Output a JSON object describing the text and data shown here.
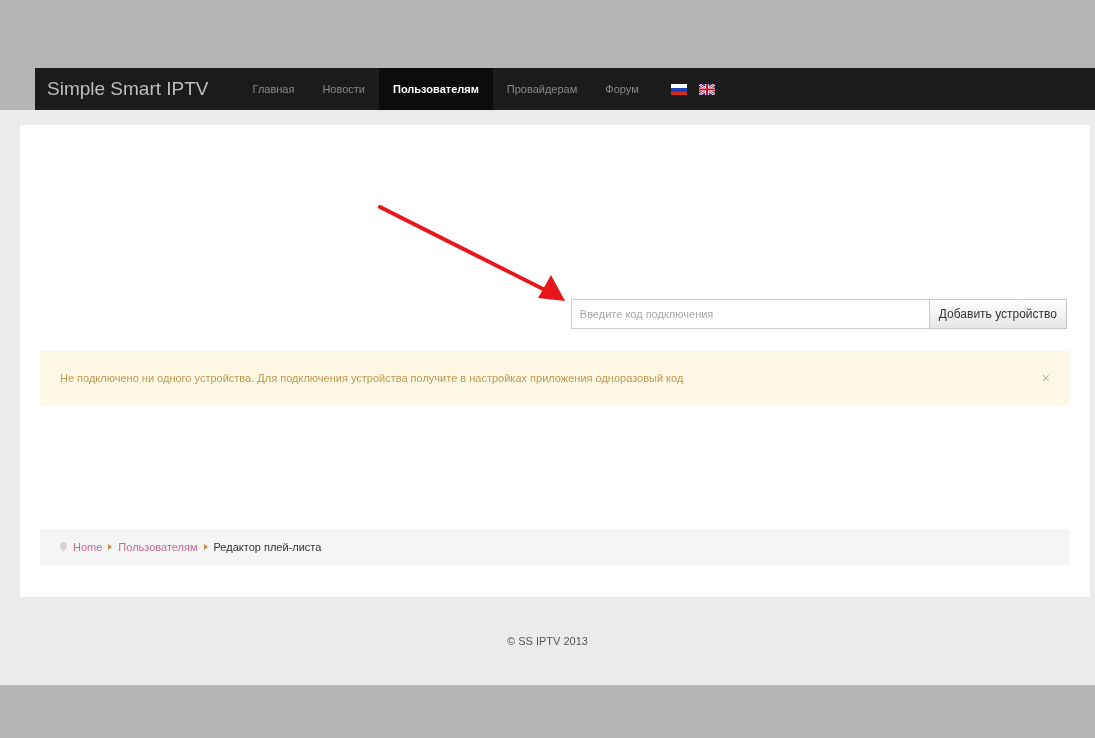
{
  "navbar": {
    "brand": "Simple Smart IPTV",
    "items": [
      {
        "label": "Главная",
        "selected": false
      },
      {
        "label": "Новости",
        "selected": false
      },
      {
        "label": "Пользователям",
        "selected": true
      },
      {
        "label": "Провайдерам",
        "selected": false
      },
      {
        "label": "Форум",
        "selected": false
      }
    ]
  },
  "device_form": {
    "placeholder": "Введите код подключения",
    "button": "Добавить устройство"
  },
  "alert": {
    "text": "Не подключено ни одного устройства. Для подключения устройства получите в настройках приложения одноразовый код",
    "close": "×"
  },
  "breadcrumb": [
    {
      "label": "Home",
      "link": true
    },
    {
      "label": "Пользователям",
      "link": true
    },
    {
      "label": "Редактор плей-листа",
      "link": false
    }
  ],
  "footer": {
    "text": "© SS IPTV 2013"
  }
}
